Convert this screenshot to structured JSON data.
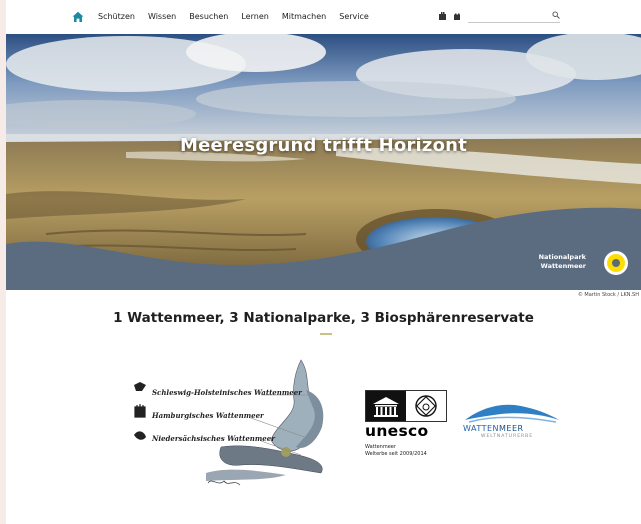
{
  "nav": {
    "menu": [
      "Schützen",
      "Wissen",
      "Besuchen",
      "Lernen",
      "Mitmachen",
      "Service"
    ],
    "search_placeholder": ""
  },
  "hero": {
    "title": "Meeresgrund trifft Horizont",
    "logo_line1": "Nationalpark",
    "logo_line2": "Wattenmeer",
    "credit": "© Martin Stock / LKN.SH"
  },
  "intro": {
    "headline": "1 Wattenmeer, 3 Nationalparke, 3 Biosphärenreservate"
  },
  "map": {
    "labels": [
      "Schleswig-Holsteinisches Wattenmeer",
      "Hamburgisches Wattenmeer",
      "Niedersächsisches Wattenmeer"
    ]
  },
  "unesco": {
    "word": "unesco",
    "line1": "Wattenmeer",
    "line2": "Welterbe seit 2009/2014"
  },
  "wattenmeer_logo": {
    "name_a": "WATTEN",
    "name_b": "MEER",
    "tagline": "WELTNATURERBE"
  },
  "colors": {
    "accent": "#1e8aa0",
    "logo_yellow": "#ffdd00",
    "ground": "#5b6b80"
  }
}
